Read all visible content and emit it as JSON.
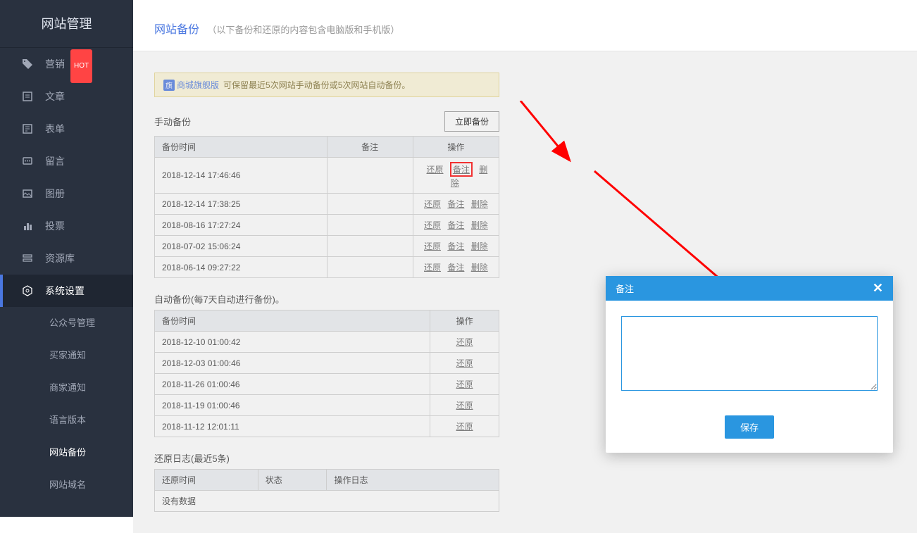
{
  "sidebar": {
    "title": "网站管理",
    "hot_badge": "HOT",
    "items": [
      {
        "label": "营销",
        "kind": "main",
        "icon": "tag"
      },
      {
        "label": "文章",
        "kind": "main",
        "icon": "article"
      },
      {
        "label": "表单",
        "kind": "main",
        "icon": "form"
      },
      {
        "label": "留言",
        "kind": "main",
        "icon": "message"
      },
      {
        "label": "图册",
        "kind": "main",
        "icon": "gallery"
      },
      {
        "label": "投票",
        "kind": "main",
        "icon": "vote"
      },
      {
        "label": "资源库",
        "kind": "main",
        "icon": "resource"
      },
      {
        "label": "系统设置",
        "kind": "main",
        "icon": "settings",
        "active": true
      },
      {
        "label": "公众号管理",
        "kind": "sub"
      },
      {
        "label": "买家通知",
        "kind": "sub"
      },
      {
        "label": "商家通知",
        "kind": "sub"
      },
      {
        "label": "语言版本",
        "kind": "sub"
      },
      {
        "label": "网站备份",
        "kind": "sub",
        "current": true
      },
      {
        "label": "网站域名",
        "kind": "sub"
      }
    ]
  },
  "header": {
    "title": "网站备份",
    "subtitle": "（以下备份和还原的内容包含电脑版和手机版）"
  },
  "notice": {
    "badge_text": "商城旗舰版",
    "text": "可保留最近5次网站手动备份或5次网站自动备份。"
  },
  "manual_backup": {
    "title": "手动备份",
    "button": "立即备份",
    "columns": {
      "time": "备份时间",
      "remark": "备注",
      "action": "操作"
    },
    "actions": {
      "restore": "还原",
      "remark": "备注",
      "delete": "删除"
    },
    "rows": [
      {
        "time": "2018-12-14 17:46:46",
        "remark": ""
      },
      {
        "time": "2018-12-14 17:38:25",
        "remark": ""
      },
      {
        "time": "2018-08-16 17:27:24",
        "remark": ""
      },
      {
        "time": "2018-07-02 15:06:24",
        "remark": ""
      },
      {
        "time": "2018-06-14 09:27:22",
        "remark": ""
      }
    ]
  },
  "auto_backup": {
    "title": "自动备份(每7天自动进行备份)。",
    "columns": {
      "time": "备份时间",
      "action": "操作"
    },
    "actions": {
      "restore": "还原"
    },
    "rows": [
      {
        "time": "2018-12-10 01:00:42"
      },
      {
        "time": "2018-12-03 01:00:46"
      },
      {
        "time": "2018-11-26 01:00:46"
      },
      {
        "time": "2018-11-19 01:00:46"
      },
      {
        "time": "2018-11-12 12:01:11"
      }
    ]
  },
  "restore_log": {
    "title": "还原日志(最近5条)",
    "columns": {
      "time": "还原时间",
      "status": "状态",
      "log": "操作日志"
    },
    "empty": "没有数据"
  },
  "modal": {
    "title": "备注",
    "save": "保存"
  }
}
